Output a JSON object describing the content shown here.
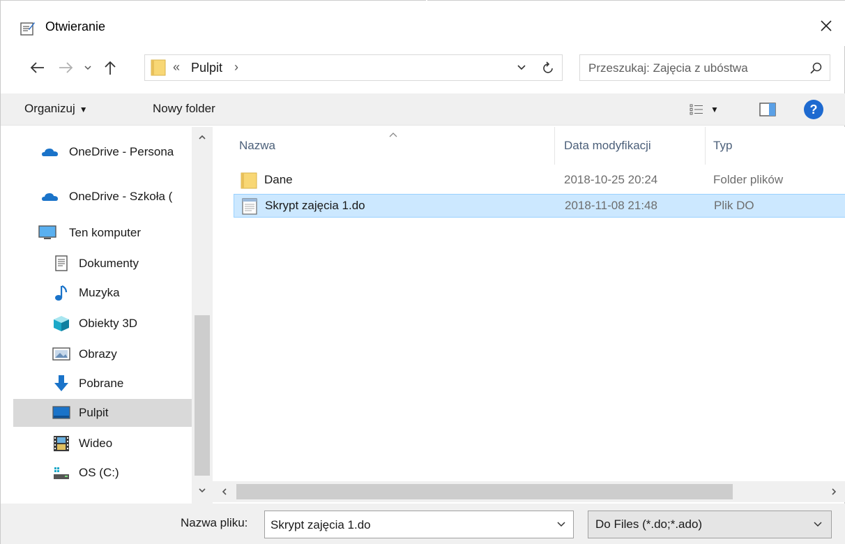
{
  "window": {
    "title": "Otwieranie"
  },
  "address": {
    "overflow_chevron": "«",
    "crumbs": [
      "Pulpit"
    ],
    "separator": "›",
    "search_placeholder": "Przeszukaj: Zajęcia z ubóstwa"
  },
  "commandbar": {
    "organize_label": "Organizuj",
    "new_folder_label": "Nowy folder"
  },
  "navpane": {
    "items": [
      {
        "label": "OneDrive - Persona",
        "icon": "cloud-icon"
      },
      {
        "label": "OneDrive - Szkoła (",
        "icon": "cloud-icon"
      },
      {
        "label": "Ten komputer",
        "icon": "computer-icon"
      },
      {
        "label": "Dokumenty",
        "icon": "documents-icon"
      },
      {
        "label": "Muzyka",
        "icon": "music-icon"
      },
      {
        "label": "Obiekty 3D",
        "icon": "objects-3d-icon"
      },
      {
        "label": "Obrazy",
        "icon": "pictures-icon"
      },
      {
        "label": "Pobrane",
        "icon": "downloads-icon"
      },
      {
        "label": "Pulpit",
        "icon": "desktop-icon",
        "selected": true
      },
      {
        "label": "Wideo",
        "icon": "video-icon"
      },
      {
        "label": "OS (C:)",
        "icon": "drive-icon"
      }
    ]
  },
  "filelist": {
    "columns": {
      "name": "Nazwa",
      "date": "Data modyfikacji",
      "type": "Typ"
    },
    "rows": [
      {
        "name": "Dane",
        "date": "2018-10-25 20:24",
        "type": "Folder plików",
        "icon": "folder-icon"
      },
      {
        "name": "Skrypt zajęcia 1.do",
        "date": "2018-11-08 21:48",
        "type": "Plik DO",
        "icon": "text-file-icon",
        "selected": true
      }
    ]
  },
  "bottom": {
    "filename_label": "Nazwa pliku:",
    "filename_value": "Skrypt zajęcia 1.do",
    "filter_value": "Do Files (*.do;*.ado)"
  },
  "colors": {
    "selection_bg": "#cce8ff",
    "selection_border": "#99d1ff",
    "nav_selected": "#d9d9d9",
    "help_blue": "#1e6ad0",
    "folder_yellow": "#f8d775",
    "onedrive_blue": "#1a73c9"
  }
}
